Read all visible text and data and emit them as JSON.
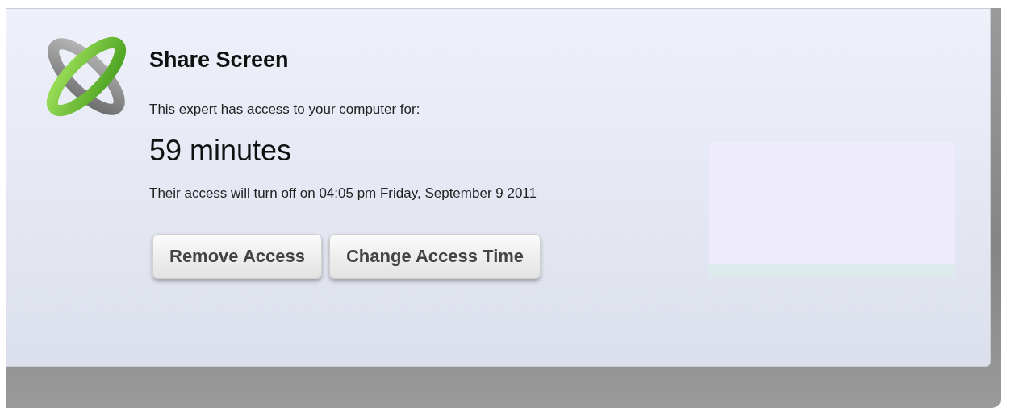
{
  "title": "Share Screen",
  "intro": "This expert has access to your computer for:",
  "remaining": "59 minutes",
  "expiry": "Their access will turn off on 04:05 pm Friday, September 9 2011",
  "buttons": [
    "Remove Access",
    "Change Access Time"
  ]
}
